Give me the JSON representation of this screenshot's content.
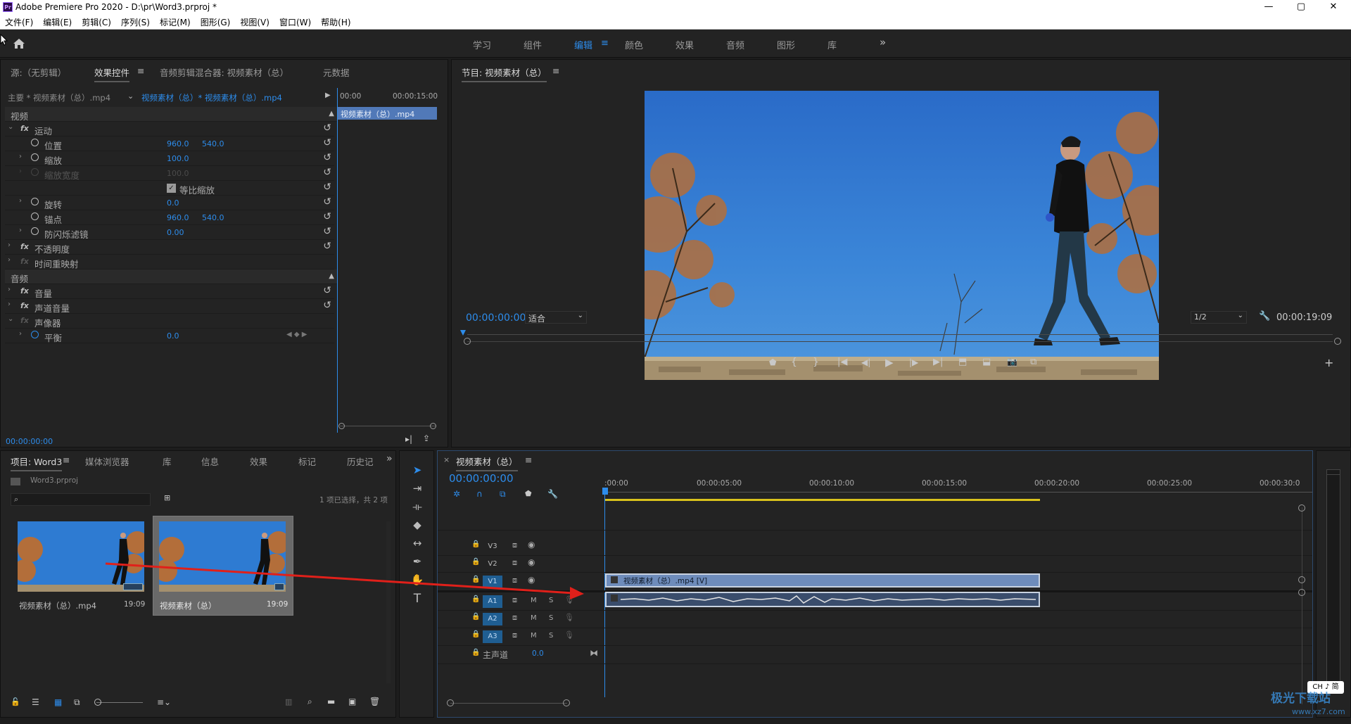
{
  "app": {
    "title": "Adobe Premiere Pro 2020 - D:\\pr\\Word3.prproj *",
    "logo": "Pr",
    "window_controls": [
      "—",
      "▢",
      "✕"
    ]
  },
  "menu": [
    "文件(F)",
    "编辑(E)",
    "剪辑(C)",
    "序列(S)",
    "标记(M)",
    "图形(G)",
    "视图(V)",
    "窗口(W)",
    "帮助(H)"
  ],
  "workspaces": {
    "items": [
      "学习",
      "组件",
      "编辑",
      "颜色",
      "效果",
      "音频",
      "图形",
      "库"
    ],
    "active": "编辑",
    "menu_icon": "≡",
    "more": "»"
  },
  "source_panel": {
    "tabs": [
      "源:（无剪辑）",
      "效果控件",
      "音频剪辑混合器: 视频素材（总）",
      "元数据"
    ],
    "active_tab": "效果控件",
    "master_clip": "主要 * 视频素材（总）.mp4",
    "sequence_clip": "视频素材（总）* 视频素材（总）.mp4",
    "mini_ruler": [
      "00:00",
      "00:00:15:00"
    ],
    "mini_clip_label": "视频素材（总）.mp4",
    "sections": {
      "video": "视频",
      "audio": "音频"
    },
    "params": {
      "motion": "运动",
      "position": {
        "label": "位置",
        "x": "960.0",
        "y": "540.0"
      },
      "scale": {
        "label": "缩放",
        "value": "100.0"
      },
      "scale_width": {
        "label": "缩放宽度",
        "value": "100.0"
      },
      "uniform_scale": "等比缩放",
      "rotation": {
        "label": "旋转",
        "value": "0.0"
      },
      "anchor": {
        "label": "锚点",
        "x": "960.0",
        "y": "540.0"
      },
      "flicker": {
        "label": "防闪烁滤镜",
        "value": "0.00"
      },
      "opacity": "不透明度",
      "time_remap": "时间重映射",
      "volume": "音量",
      "channel_volume": "声道音量",
      "panner": "声像器",
      "balance": {
        "label": "平衡",
        "value": "0.0"
      }
    },
    "timecode": "00:00:00:00"
  },
  "program_monitor": {
    "title": "节目: 视频素材（总）",
    "timecode_in": "00:00:00:00",
    "fit": "适合",
    "resolution": "1/2",
    "duration": "00:00:19:09"
  },
  "project_panel": {
    "tabs": [
      "项目: Word3",
      "媒体浏览器",
      "库",
      "信息",
      "效果",
      "标记",
      "历史记"
    ],
    "active_tab": "项目: Word3",
    "file": "Word3.prproj",
    "selection_info": "1 项已选择，共 2 项",
    "items": [
      {
        "name": "视频素材（总）.mp4",
        "duration": "19:09"
      },
      {
        "name": "视频素材（总）",
        "duration": "19:09"
      }
    ]
  },
  "timeline": {
    "title": "视频素材（总）",
    "timecode": "00:00:00:00",
    "ruler": [
      ":00:00",
      "00:00:05:00",
      "00:00:10:00",
      "00:00:15:00",
      "00:00:20:00",
      "00:00:25:00",
      "00:00:30:0"
    ],
    "video_tracks": [
      "V3",
      "V2",
      "V1"
    ],
    "audio_tracks": [
      "A1",
      "A2",
      "A3"
    ],
    "master_track": {
      "label": "主声道",
      "value": "0.0"
    },
    "video_clip_label": "视频素材（总）.mp4 [V]",
    "track_buttons": {
      "mute": "M",
      "solo": "S"
    }
  },
  "watermark": {
    "text": "极光下载站",
    "ime": "CH ♪ 简",
    "url": "www.xz7.com"
  },
  "colors": {
    "accent": "#2d8ceb",
    "arrow": "#e0201a",
    "video_clip": "#5a7fb5",
    "audio_clip": "#3b4e6e"
  },
  "icons": [
    "home-icon",
    "play-icon",
    "wrench-icon",
    "camera-icon",
    "search-icon",
    "folder-icon",
    "trash-icon",
    "selection-tool-icon",
    "pen-tool-icon",
    "hand-tool-icon",
    "type-tool-icon",
    "eye-icon",
    "lock-icon"
  ]
}
